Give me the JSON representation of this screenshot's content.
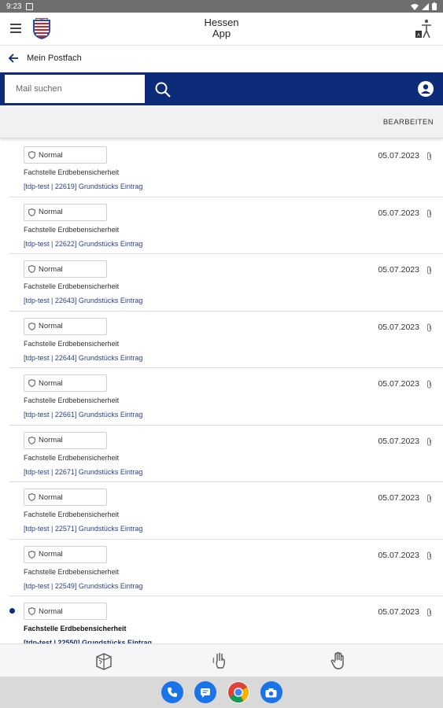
{
  "status_bar": {
    "time": "9:23"
  },
  "header": {
    "title_line1": "Hessen",
    "title_line2": "App"
  },
  "nav": {
    "back_label": "Mein Postfach"
  },
  "search": {
    "placeholder": "Mail suchen"
  },
  "toolbar": {
    "edit_label": "BEARBEITEN"
  },
  "mails": [
    {
      "priority": "Normal",
      "sender": "Fachstelle Erdbebensicherheit",
      "subject": "[tdp-test | 22619] Grundstücks Eintrag",
      "date": "05.07.2023",
      "unread": false
    },
    {
      "priority": "Normal",
      "sender": "Fachstelle Erdbebensicherheit",
      "subject": "[tdp-test | 22622] Grundstücks Eintrag",
      "date": "05.07.2023",
      "unread": false
    },
    {
      "priority": "Normal",
      "sender": "Fachstelle Erdbebensicherheit",
      "subject": "[tdp-test | 22643] Grundstücks Eintrag",
      "date": "05.07.2023",
      "unread": false
    },
    {
      "priority": "Normal",
      "sender": "Fachstelle Erdbebensicherheit",
      "subject": "[tdp-test | 22644] Grundstücks Eintrag",
      "date": "05.07.2023",
      "unread": false
    },
    {
      "priority": "Normal",
      "sender": "Fachstelle Erdbebensicherheit",
      "subject": "[tdp-test | 22661] Grundstücks Eintrag",
      "date": "05.07.2023",
      "unread": false
    },
    {
      "priority": "Normal",
      "sender": "Fachstelle Erdbebensicherheit",
      "subject": "[tdp-test | 22671] Grundstücks Eintrag",
      "date": "05.07.2023",
      "unread": false
    },
    {
      "priority": "Normal",
      "sender": "Fachstelle Erdbebensicherheit",
      "subject": "[tdp-test | 22571] Grundstücks Eintrag",
      "date": "05.07.2023",
      "unread": false
    },
    {
      "priority": "Normal",
      "sender": "Fachstelle Erdbebensicherheit",
      "subject": "[tdp-test | 22549] Grundstücks Eintrag",
      "date": "05.07.2023",
      "unread": false
    },
    {
      "priority": "Normal",
      "sender": "Fachstelle Erdbebensicherheit",
      "subject": "[tdp-test | 22550] Grundstücks Eintrag",
      "date": "05.07.2023",
      "unread": true
    }
  ],
  "bottom_nav": {
    "icons": [
      "map-book-icon",
      "sign-language-icon",
      "hand-icon"
    ]
  },
  "dock": {
    "apps": [
      "phone-app-icon",
      "messages-app-icon",
      "chrome-app-icon",
      "camera-app-icon"
    ]
  },
  "colors": {
    "brand": "#0c2c7a",
    "link": "#2c3f8f"
  }
}
